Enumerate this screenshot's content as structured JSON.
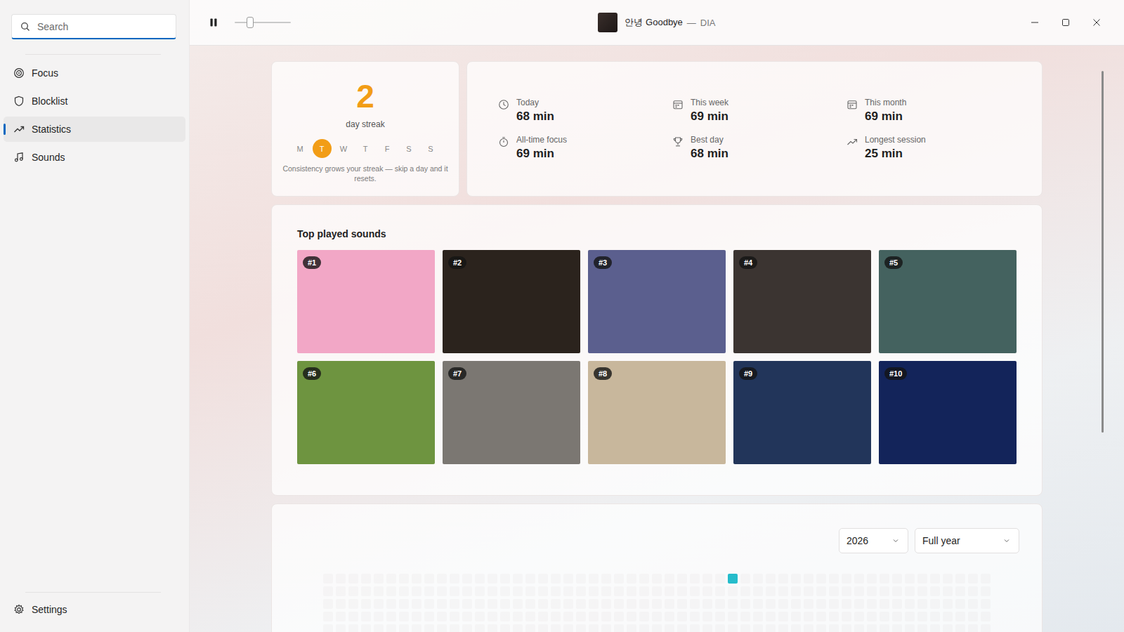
{
  "sidebar": {
    "search": {
      "placeholder": "Search"
    },
    "items": [
      {
        "label": "Focus",
        "selected": false
      },
      {
        "label": "Blocklist",
        "selected": false
      },
      {
        "label": "Statistics",
        "selected": true
      },
      {
        "label": "Sounds",
        "selected": false
      }
    ],
    "footer": {
      "label": "Settings",
      "selected": false
    }
  },
  "player": {
    "playing": true,
    "volume": 0.24,
    "title": "안녕 Goodbye",
    "separator": "—",
    "artist": "DIA"
  },
  "streak": {
    "count": "2",
    "label": "day streak",
    "days": [
      {
        "label": "M",
        "selected": false
      },
      {
        "label": "T",
        "selected": true
      },
      {
        "label": "W",
        "selected": false
      },
      {
        "label": "T",
        "selected": false
      },
      {
        "label": "F",
        "selected": false
      },
      {
        "label": "S",
        "selected": false
      },
      {
        "label": "S",
        "selected": false
      }
    ],
    "note": "Consistency grows your streak — skip a day and it resets."
  },
  "stats": [
    {
      "label": "Today",
      "value": "68 min"
    },
    {
      "label": "This week",
      "value": "69 min"
    },
    {
      "label": "This month",
      "value": "69 min"
    },
    {
      "label": "All-time focus",
      "value": "69 min"
    },
    {
      "label": "Best day",
      "value": "68 min"
    },
    {
      "label": "Longest session",
      "value": "25 min"
    }
  ],
  "top_sounds": {
    "title": "Top played sounds",
    "items": [
      {
        "rank": "#1",
        "color": "#f2a7c6"
      },
      {
        "rank": "#2",
        "color": "#2b231d"
      },
      {
        "rank": "#3",
        "color": "#5b5f8e"
      },
      {
        "rank": "#4",
        "color": "#3b3431"
      },
      {
        "rank": "#5",
        "color": "#44625f"
      },
      {
        "rank": "#6",
        "color": "#6e9440"
      },
      {
        "rank": "#7",
        "color": "#7b7772"
      },
      {
        "rank": "#8",
        "color": "#c8b79c"
      },
      {
        "rank": "#9",
        "color": "#22355a"
      },
      {
        "rank": "#10",
        "color": "#13245a"
      }
    ]
  },
  "heatmap": {
    "year": "2026",
    "range": "Full year",
    "weeks": 53,
    "days": 7,
    "cells": [
      {
        "week": 32,
        "day": 0,
        "level": 1
      }
    ]
  },
  "scrollbar": {
    "level": 0.66
  }
}
